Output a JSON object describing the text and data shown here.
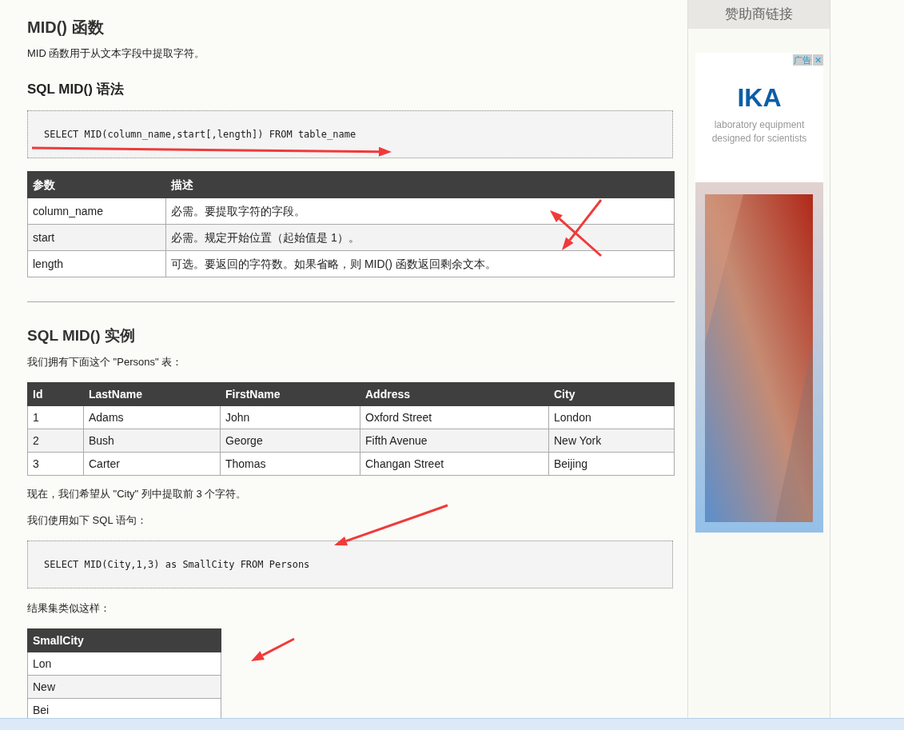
{
  "article": {
    "title": "MID() 函数",
    "intro": "MID 函数用于从文本字段中提取字符。",
    "syntax_heading": "SQL MID() 语法",
    "syntax_code": "SELECT MID(column_name,start[,length]) FROM table_name",
    "param_table": {
      "columns": [
        "参数",
        "描述"
      ],
      "rows": [
        [
          "column_name",
          "必需。要提取字符的字段。"
        ],
        [
          "start",
          "必需。规定开始位置（起始值是 1）。"
        ],
        [
          "length",
          "可选。要返回的字符数。如果省略，则 MID() 函数返回剩余文本。"
        ]
      ]
    },
    "example_heading": "SQL MID() 实例",
    "example_intro": "我们拥有下面这个 \"Persons\" 表：",
    "persons_table": {
      "columns": [
        "Id",
        "LastName",
        "FirstName",
        "Address",
        "City"
      ],
      "rows": [
        [
          "1",
          "Adams",
          "John",
          "Oxford Street",
          "London"
        ],
        [
          "2",
          "Bush",
          "George",
          "Fifth Avenue",
          "New York"
        ],
        [
          "3",
          "Carter",
          "Thomas",
          "Changan Street",
          "Beijing"
        ]
      ]
    },
    "goal_text": "现在，我们希望从 \"City\" 列中提取前 3 个字符。",
    "query_intro": "我们使用如下 SQL 语句：",
    "query_code": "SELECT MID(City,1,3) as SmallCity FROM Persons",
    "result_intro": "结果集类似这样：",
    "result_table": {
      "columns": [
        "SmallCity"
      ],
      "rows": [
        [
          "Lon"
        ],
        [
          "New"
        ],
        [
          "Bei"
        ]
      ]
    }
  },
  "sidebar": {
    "title": "赞助商链接",
    "ad": {
      "badge": "广告",
      "close": "✕",
      "logo": "IKA",
      "tagline": "laboratory equipment designed for scientists",
      "kind": "picture"
    }
  }
}
